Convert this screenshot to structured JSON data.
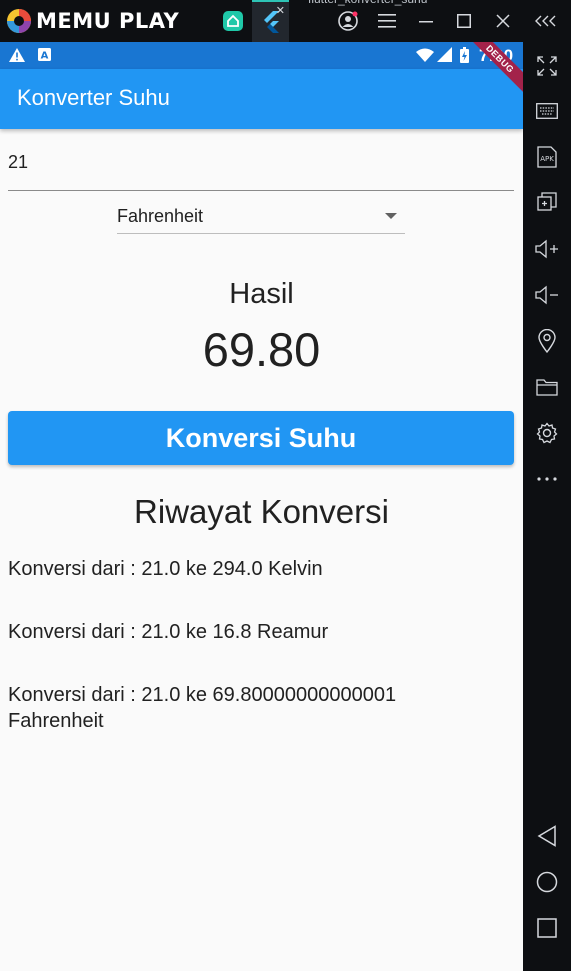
{
  "emulator": {
    "logo_text": "MEMU PLAY",
    "tab_title": "flutter_konverter_suhu"
  },
  "status_bar": {
    "time": "7:00"
  },
  "app": {
    "title": "Konverter Suhu",
    "debug_banner": "DEBUG"
  },
  "form": {
    "input_value": "21",
    "dropdown_selected": "Fahrenheit"
  },
  "result": {
    "label": "Hasil",
    "value": "69.80"
  },
  "convert_button": {
    "label": "Konversi Suhu"
  },
  "history": {
    "title": "Riwayat Konversi",
    "items": [
      "Konversi dari : 21.0 ke 294.0 Kelvin",
      "Konversi dari : 21.0 ke 16.8 Reamur",
      "Konversi dari : 21.0 ke 69.80000000000001 Fahrenheit"
    ]
  },
  "colors": {
    "app_bar": "#2196f3",
    "status_bar": "#1976d2",
    "button": "#2196f3",
    "debug_banner": "#a3224a"
  }
}
